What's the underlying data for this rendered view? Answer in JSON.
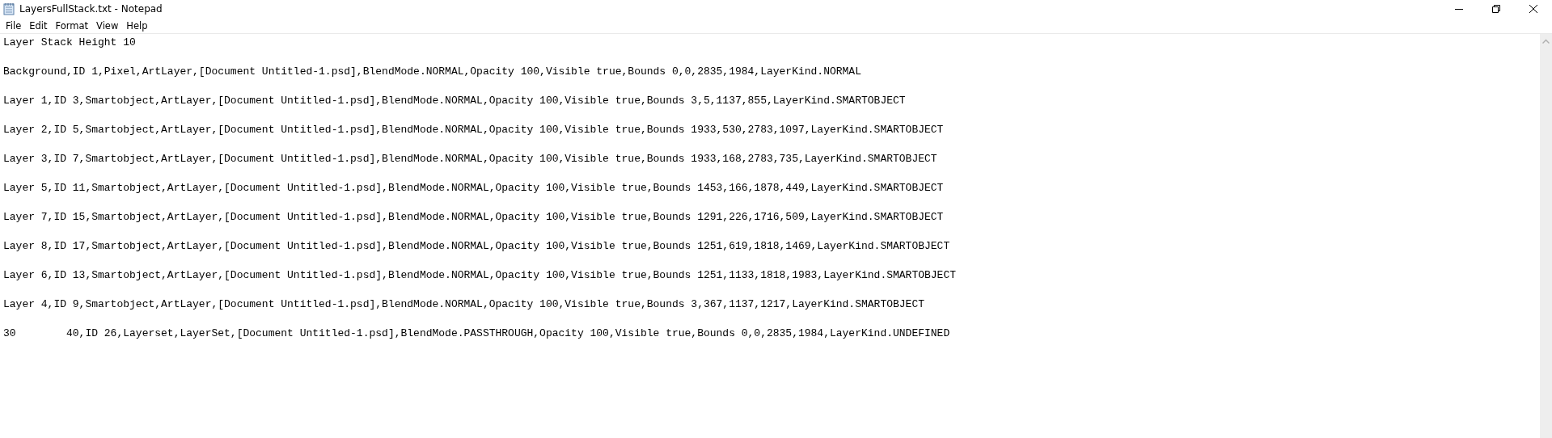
{
  "window": {
    "title": "LayersFullStack.txt - Notepad"
  },
  "menu": [
    "File",
    "Edit",
    "Format",
    "View",
    "Help"
  ],
  "document": {
    "lines": [
      "Layer Stack Height 10",
      "Background,ID 1,Pixel,ArtLayer,[Document Untitled-1.psd],BlendMode.NORMAL,Opacity 100,Visible true,Bounds 0,0,2835,1984,LayerKind.NORMAL",
      "Layer 1,ID 3,Smartobject,ArtLayer,[Document Untitled-1.psd],BlendMode.NORMAL,Opacity 100,Visible true,Bounds 3,5,1137,855,LayerKind.SMARTOBJECT",
      "Layer 2,ID 5,Smartobject,ArtLayer,[Document Untitled-1.psd],BlendMode.NORMAL,Opacity 100,Visible true,Bounds 1933,530,2783,1097,LayerKind.SMARTOBJECT",
      "Layer 3,ID 7,Smartobject,ArtLayer,[Document Untitled-1.psd],BlendMode.NORMAL,Opacity 100,Visible true,Bounds 1933,168,2783,735,LayerKind.SMARTOBJECT",
      "Layer 5,ID 11,Smartobject,ArtLayer,[Document Untitled-1.psd],BlendMode.NORMAL,Opacity 100,Visible true,Bounds 1453,166,1878,449,LayerKind.SMARTOBJECT",
      "Layer 7,ID 15,Smartobject,ArtLayer,[Document Untitled-1.psd],BlendMode.NORMAL,Opacity 100,Visible true,Bounds 1291,226,1716,509,LayerKind.SMARTOBJECT",
      "Layer 8,ID 17,Smartobject,ArtLayer,[Document Untitled-1.psd],BlendMode.NORMAL,Opacity 100,Visible true,Bounds 1251,619,1818,1469,LayerKind.SMARTOBJECT",
      "Layer 6,ID 13,Smartobject,ArtLayer,[Document Untitled-1.psd],BlendMode.NORMAL,Opacity 100,Visible true,Bounds 1251,1133,1818,1983,LayerKind.SMARTOBJECT",
      "Layer 4,ID 9,Smartobject,ArtLayer,[Document Untitled-1.psd],BlendMode.NORMAL,Opacity 100,Visible true,Bounds 3,367,1137,1217,LayerKind.SMARTOBJECT",
      "30\t40,ID 26,Layerset,LayerSet,[Document Untitled-1.psd],BlendMode.PASSTHROUGH,Opacity 100,Visible true,Bounds 0,0,2835,1984,LayerKind.UNDEFINED"
    ]
  }
}
